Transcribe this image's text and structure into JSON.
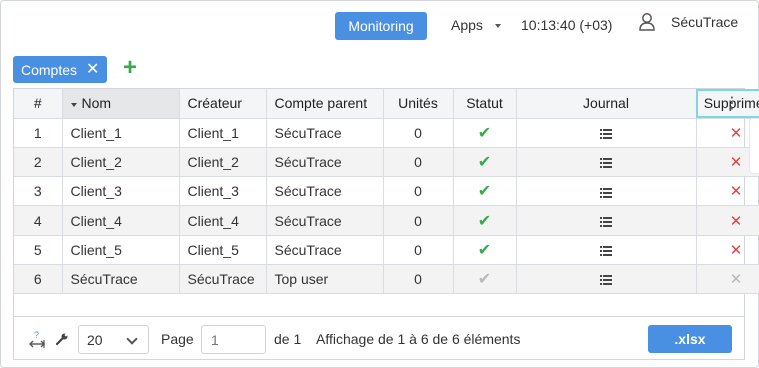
{
  "header": {
    "monitoring_label": "Monitoring",
    "apps_label": "Apps",
    "clock": "10:13:40 (+03)",
    "user_name": "SécuTrace"
  },
  "tabs": {
    "active_tab_label": "Comptes"
  },
  "table": {
    "columns": [
      "#",
      "Nom",
      "Créateur",
      "Compte parent",
      "Unités",
      "Statut",
      "Journal",
      "Supprimer"
    ],
    "sorted_column": "Nom",
    "selected_column": "Supprimer",
    "rows": [
      {
        "num": "1",
        "nom": "Client_1",
        "createur": "Client_1",
        "parent": "SécuTrace",
        "unites": "0",
        "statut": "active",
        "delete": "enabled"
      },
      {
        "num": "2",
        "nom": "Client_2",
        "createur": "Client_2",
        "parent": "SécuTrace",
        "unites": "0",
        "statut": "active",
        "delete": "enabled"
      },
      {
        "num": "3",
        "nom": "Client_3",
        "createur": "Client_3",
        "parent": "SécuTrace",
        "unites": "0",
        "statut": "active",
        "delete": "enabled"
      },
      {
        "num": "4",
        "nom": "Client_4",
        "createur": "Client_4",
        "parent": "SécuTrace",
        "unites": "0",
        "statut": "active",
        "delete": "enabled"
      },
      {
        "num": "5",
        "nom": "Client_5",
        "createur": "Client_5",
        "parent": "SécuTrace",
        "unites": "0",
        "statut": "active",
        "delete": "enabled"
      },
      {
        "num": "6",
        "nom": "SécuTrace",
        "createur": "SécuTrace",
        "parent": "Top user",
        "unites": "0",
        "statut": "inactive",
        "delete": "disabled"
      }
    ]
  },
  "footer": {
    "per_page": "20",
    "page_label": "Page",
    "page_placeholder": "1",
    "of_label": "de 1",
    "display_text": "Affichage de 1 à 6 de 6 éléments",
    "export_label": ".xlsx"
  },
  "colors": {
    "accent": "#4a90e2",
    "success": "#3aa94a",
    "danger": "#e04646",
    "disabled": "#b9b9b9"
  },
  "icons": [
    "user-icon",
    "close-icon",
    "plus-icon",
    "sort-down-icon",
    "kebab-menu-icon",
    "check-icon",
    "list-icon",
    "delete-x-icon",
    "autosize-icon",
    "wrench-icon",
    "chevron-down-icon"
  ]
}
